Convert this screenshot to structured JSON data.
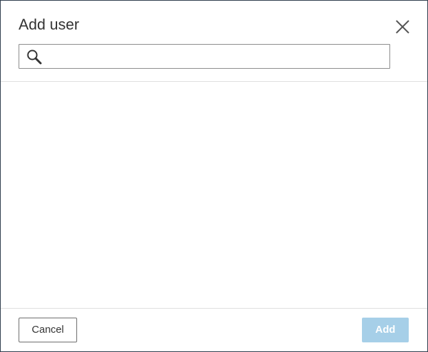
{
  "dialog": {
    "title": "Add user",
    "search": {
      "value": "",
      "placeholder": ""
    },
    "results": [],
    "footer": {
      "cancel_label": "Cancel",
      "add_label": "Add",
      "add_enabled": false
    }
  },
  "icons": {
    "close": "close-icon",
    "search": "search-icon"
  },
  "colors": {
    "add_button_disabled_bg": "#a6cfe8",
    "dialog_border": "#2b3a4a",
    "divider": "#dedede"
  }
}
